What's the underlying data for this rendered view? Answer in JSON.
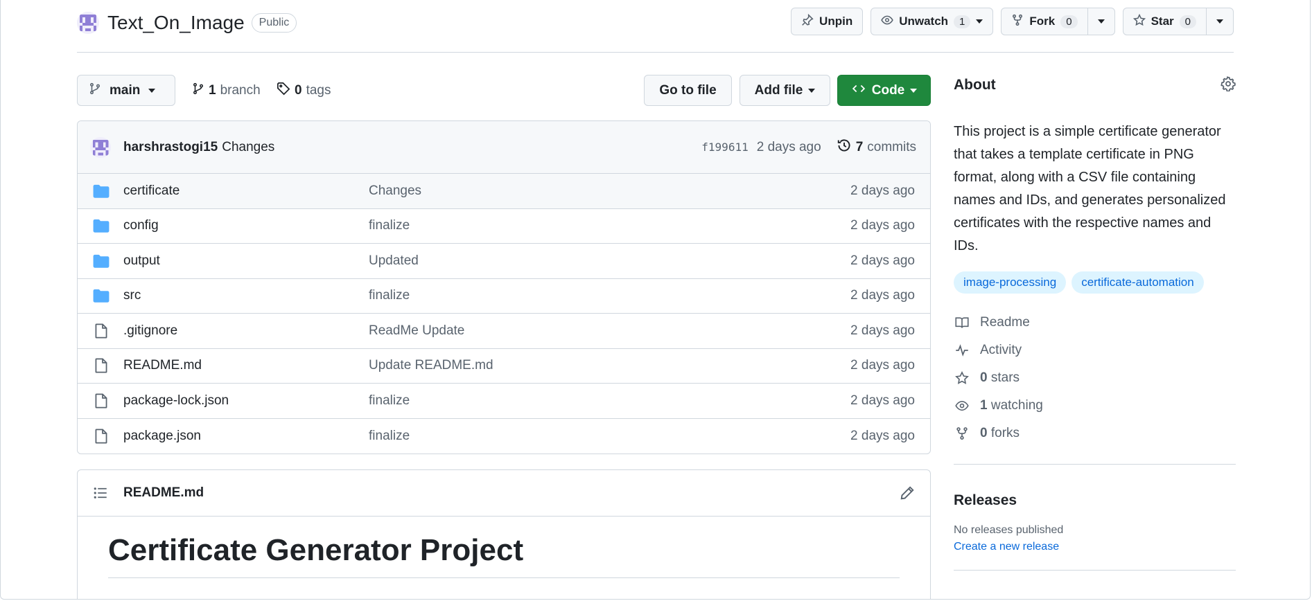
{
  "repo": {
    "name": "Text_On_Image",
    "visibility": "Public"
  },
  "header_actions": {
    "unpin_label": "Unpin",
    "unwatch_label": "Unwatch",
    "watch_count": "1",
    "fork_label": "Fork",
    "fork_count": "0",
    "star_label": "Star",
    "star_count": "0"
  },
  "toolbar": {
    "branch": "main",
    "branch_count": "1",
    "branch_word": "branch",
    "tag_count": "0",
    "tag_word": "tags",
    "go_to_file": "Go to file",
    "add_file": "Add file",
    "code": "Code"
  },
  "latest_commit": {
    "author": "harshrastogi15",
    "message": "Changes",
    "sha": "f199611",
    "age": "2 days ago",
    "commit_count": "7",
    "commit_word": "commits"
  },
  "files": [
    {
      "name": "certificate",
      "type": "folder",
      "message": "Changes",
      "age": "2 days ago"
    },
    {
      "name": "config",
      "type": "folder",
      "message": "finalize",
      "age": "2 days ago"
    },
    {
      "name": "output",
      "type": "folder",
      "message": "Updated",
      "age": "2 days ago"
    },
    {
      "name": "src",
      "type": "folder",
      "message": "finalize",
      "age": "2 days ago"
    },
    {
      "name": ".gitignore",
      "type": "file",
      "message": "ReadMe Update",
      "age": "2 days ago"
    },
    {
      "name": "README.md",
      "type": "file",
      "message": "Update README.md",
      "age": "2 days ago"
    },
    {
      "name": "package-lock.json",
      "type": "file",
      "message": "finalize",
      "age": "2 days ago"
    },
    {
      "name": "package.json",
      "type": "file",
      "message": "finalize",
      "age": "2 days ago"
    }
  ],
  "readme": {
    "filename": "README.md",
    "title": "Certificate Generator Project"
  },
  "about": {
    "title": "About",
    "description": "This project is a simple certificate generator that takes a template certificate in PNG format, along with a CSV file containing names and IDs, and generates personalized certificates with the respective names and IDs.",
    "topics": [
      "image-processing",
      "certificate-automation"
    ],
    "readme_label": "Readme",
    "activity_label": "Activity",
    "stars_count": "0",
    "stars_word": "stars",
    "watching_count": "1",
    "watching_word": "watching",
    "forks_count": "0",
    "forks_word": "forks"
  },
  "releases": {
    "title": "Releases",
    "none_text": "No releases published",
    "create_link": "Create a new release"
  },
  "colors": {
    "accent_green": "#1f883d",
    "link_blue": "#0969da",
    "folder_blue": "#54aeff",
    "topic_bg": "#ddf4ff"
  }
}
